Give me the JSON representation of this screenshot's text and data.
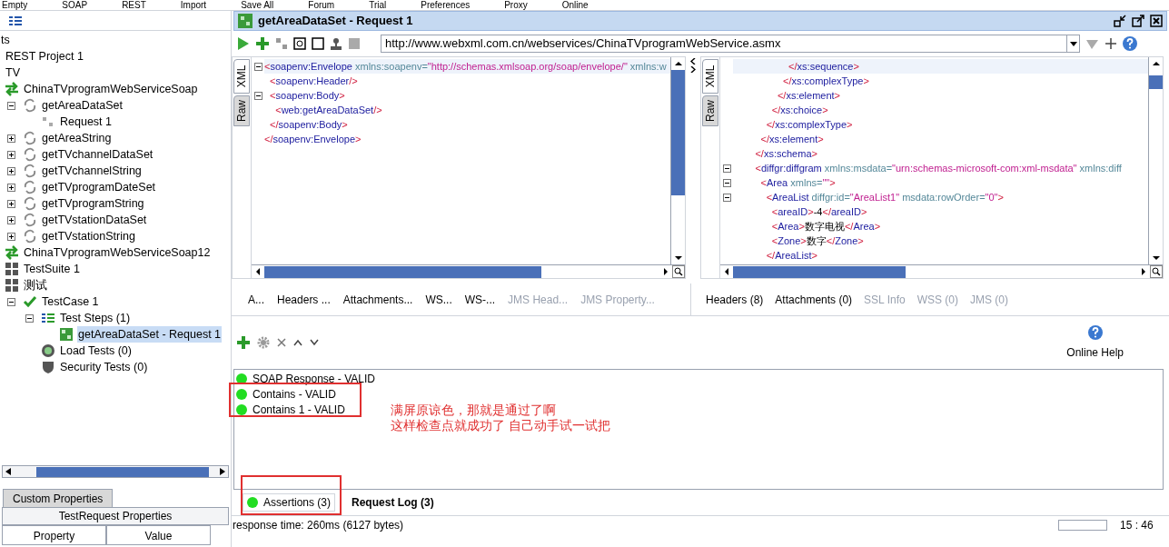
{
  "menu": [
    "Empty",
    "SOAP",
    "REST",
    "Import",
    "Save All",
    "Forum",
    "Trial",
    "Preferences",
    "Proxy",
    "Online"
  ],
  "tree": [
    {
      "label": "ts",
      "children": [
        {
          "label": "REST Project 1"
        },
        {
          "label": "TV",
          "children": [
            {
              "label": "ChinaTVprogramWebServiceSoap",
              "kind": "interface",
              "children": [
                {
                  "label": "getAreaDataSet",
                  "kind": "operation",
                  "expanded": true,
                  "children": [
                    {
                      "label": "Request 1",
                      "kind": "request"
                    }
                  ]
                },
                {
                  "label": "getAreaString",
                  "kind": "operation",
                  "expanded": false
                },
                {
                  "label": "getTVchannelDataSet",
                  "kind": "operation",
                  "expanded": false
                },
                {
                  "label": "getTVchannelString",
                  "kind": "operation",
                  "expanded": false
                },
                {
                  "label": "getTVprogramDateSet",
                  "kind": "operation",
                  "expanded": false
                },
                {
                  "label": "getTVprogramString",
                  "kind": "operation",
                  "expanded": false
                },
                {
                  "label": "getTVstationDataSet",
                  "kind": "operation",
                  "expanded": false
                },
                {
                  "label": "getTVstationString",
                  "kind": "operation",
                  "expanded": false
                }
              ]
            },
            {
              "label": "ChinaTVprogramWebServiceSoap12",
              "kind": "interface"
            },
            {
              "label": "TestSuite 1",
              "kind": "suite"
            },
            {
              "label": "测试",
              "kind": "suite",
              "children": [
                {
                  "label": "TestCase 1",
                  "kind": "case",
                  "expanded": true,
                  "children": [
                    {
                      "label": "Test Steps (1)",
                      "kind": "steps",
                      "expanded": true,
                      "children": [
                        {
                          "label": "getAreaDataSet - Request 1",
                          "kind": "step",
                          "selected": true
                        }
                      ]
                    },
                    {
                      "label": "Load Tests (0)",
                      "kind": "load"
                    },
                    {
                      "label": "Security Tests (0)",
                      "kind": "security"
                    }
                  ]
                }
              ]
            }
          ]
        }
      ]
    }
  ],
  "props": {
    "tabs": [
      {
        "label": "Custom Properties",
        "selected": true
      }
    ],
    "title": "TestRequest Properties",
    "columns": [
      "Property",
      "Value"
    ]
  },
  "editor": {
    "title": "getAreaDataSet - Request 1",
    "url": "http://www.webxml.com.cn/webservices/ChinaTVprogramWebService.asmx",
    "request": {
      "side_tabs": [
        "XML",
        "Raw"
      ],
      "lines": [
        {
          "fold": true,
          "parts": [
            {
              "kind": "punct",
              "text": "<"
            },
            {
              "kind": "tag",
              "text": "soapenv:Envelope"
            },
            {
              "kind": "attr",
              "text": " xmlns:soapenv="
            },
            {
              "kind": "value",
              "text": "\"http://schemas.xmlsoap.org/soap/envelope/\""
            },
            {
              "kind": "attr",
              "text": " xmlns:w"
            }
          ]
        },
        {
          "fold": false,
          "parts": [
            {
              "kind": "punct",
              "text": "  <"
            },
            {
              "kind": "tag",
              "text": "soapenv:Header"
            },
            {
              "kind": "punct",
              "text": "/>"
            }
          ]
        },
        {
          "fold": true,
          "parts": [
            {
              "kind": "punct",
              "text": "  <"
            },
            {
              "kind": "tag",
              "text": "soapenv:Body"
            },
            {
              "kind": "punct",
              "text": ">"
            }
          ]
        },
        {
          "fold": false,
          "parts": [
            {
              "kind": "punct",
              "text": "    <"
            },
            {
              "kind": "tag",
              "text": "web:getAreaDataSet"
            },
            {
              "kind": "punct",
              "text": "/>"
            }
          ]
        },
        {
          "fold": false,
          "parts": [
            {
              "kind": "punct",
              "text": "  </"
            },
            {
              "kind": "tag",
              "text": "soapenv:Body"
            },
            {
              "kind": "punct",
              "text": ">"
            }
          ]
        },
        {
          "fold": false,
          "parts": [
            {
              "kind": "punct",
              "text": "</"
            },
            {
              "kind": "tag",
              "text": "soapenv:Envelope"
            },
            {
              "kind": "punct",
              "text": ">"
            }
          ]
        }
      ],
      "tabs": [
        {
          "label": "A...",
          "disabled": false
        },
        {
          "label": "Headers ...",
          "disabled": false
        },
        {
          "label": "Attachments...",
          "disabled": false
        },
        {
          "label": "WS...",
          "disabled": false
        },
        {
          "label": "WS-...",
          "disabled": false
        },
        {
          "label": "JMS Head...",
          "disabled": true
        },
        {
          "label": "JMS Property...",
          "disabled": true
        }
      ]
    },
    "response": {
      "side_tabs": [
        "XML",
        "Raw"
      ],
      "lines": [
        {
          "fold": false,
          "parts": [
            {
              "kind": "punct",
              "text": "                    </"
            },
            {
              "kind": "tag",
              "text": "xs:sequence"
            },
            {
              "kind": "punct",
              "text": ">"
            }
          ]
        },
        {
          "fold": false,
          "parts": [
            {
              "kind": "punct",
              "text": "                  </"
            },
            {
              "kind": "tag",
              "text": "xs:complexType"
            },
            {
              "kind": "punct",
              "text": ">"
            }
          ]
        },
        {
          "fold": false,
          "parts": [
            {
              "kind": "punct",
              "text": "                </"
            },
            {
              "kind": "tag",
              "text": "xs:element"
            },
            {
              "kind": "punct",
              "text": ">"
            }
          ]
        },
        {
          "fold": false,
          "parts": [
            {
              "kind": "punct",
              "text": "              </"
            },
            {
              "kind": "tag",
              "text": "xs:choice"
            },
            {
              "kind": "punct",
              "text": ">"
            }
          ]
        },
        {
          "fold": false,
          "parts": [
            {
              "kind": "punct",
              "text": "            </"
            },
            {
              "kind": "tag",
              "text": "xs:complexType"
            },
            {
              "kind": "punct",
              "text": ">"
            }
          ]
        },
        {
          "fold": false,
          "parts": [
            {
              "kind": "punct",
              "text": "          </"
            },
            {
              "kind": "tag",
              "text": "xs:element"
            },
            {
              "kind": "punct",
              "text": ">"
            }
          ]
        },
        {
          "fold": false,
          "parts": [
            {
              "kind": "punct",
              "text": "        </"
            },
            {
              "kind": "tag",
              "text": "xs:schema"
            },
            {
              "kind": "punct",
              "text": ">"
            }
          ]
        },
        {
          "fold": true,
          "parts": [
            {
              "kind": "punct",
              "text": "        <"
            },
            {
              "kind": "tag",
              "text": "diffgr:diffgram"
            },
            {
              "kind": "attr",
              "text": " xmlns:msdata="
            },
            {
              "kind": "value",
              "text": "\"urn:schemas-microsoft-com:xml-msdata\""
            },
            {
              "kind": "attr",
              "text": " xmlns:diff"
            }
          ]
        },
        {
          "fold": true,
          "parts": [
            {
              "kind": "punct",
              "text": "          <"
            },
            {
              "kind": "tag",
              "text": "Area"
            },
            {
              "kind": "attr",
              "text": " xmlns="
            },
            {
              "kind": "value",
              "text": "\"\""
            },
            {
              "kind": "punct",
              "text": ">"
            }
          ]
        },
        {
          "fold": true,
          "parts": [
            {
              "kind": "punct",
              "text": "            <"
            },
            {
              "kind": "tag",
              "text": "AreaList"
            },
            {
              "kind": "attr",
              "text": " diffgr:id="
            },
            {
              "kind": "value",
              "text": "\"AreaList1\""
            },
            {
              "kind": "attr",
              "text": " msdata:rowOrder="
            },
            {
              "kind": "value",
              "text": "\"0\""
            },
            {
              "kind": "punct",
              "text": ">"
            }
          ]
        },
        {
          "fold": false,
          "parts": [
            {
              "kind": "punct",
              "text": "              <"
            },
            {
              "kind": "tag",
              "text": "areaID"
            },
            {
              "kind": "punct",
              "text": ">"
            },
            {
              "kind": "text",
              "text": "-4"
            },
            {
              "kind": "punct",
              "text": "</"
            },
            {
              "kind": "tag",
              "text": "areaID"
            },
            {
              "kind": "punct",
              "text": ">"
            }
          ]
        },
        {
          "fold": false,
          "parts": [
            {
              "kind": "punct",
              "text": "              <"
            },
            {
              "kind": "tag",
              "text": "Area"
            },
            {
              "kind": "punct",
              "text": ">"
            },
            {
              "kind": "text",
              "text": "数字电视"
            },
            {
              "kind": "punct",
              "text": "</"
            },
            {
              "kind": "tag",
              "text": "Area"
            },
            {
              "kind": "punct",
              "text": ">"
            }
          ]
        },
        {
          "fold": false,
          "parts": [
            {
              "kind": "punct",
              "text": "              <"
            },
            {
              "kind": "tag",
              "text": "Zone"
            },
            {
              "kind": "punct",
              "text": ">"
            },
            {
              "kind": "text",
              "text": "数字"
            },
            {
              "kind": "punct",
              "text": "</"
            },
            {
              "kind": "tag",
              "text": "Zone"
            },
            {
              "kind": "punct",
              "text": ">"
            }
          ]
        },
        {
          "fold": false,
          "parts": [
            {
              "kind": "punct",
              "text": "            </"
            },
            {
              "kind": "tag",
              "text": "AreaList"
            },
            {
              "kind": "punct",
              "text": ">"
            }
          ]
        }
      ],
      "tabs": [
        {
          "label": "Headers (8)",
          "disabled": false
        },
        {
          "label": "Attachments (0)",
          "disabled": false
        },
        {
          "label": "SSL Info",
          "disabled": true
        },
        {
          "label": "WSS (0)",
          "disabled": true
        },
        {
          "label": "JMS (0)",
          "disabled": true
        }
      ]
    }
  },
  "assertions": {
    "help": "Online Help",
    "items": [
      {
        "label": "SOAP Response - VALID",
        "color": "#22dd22"
      },
      {
        "label": "Contains - VALID",
        "color": "#22dd22"
      },
      {
        "label": "Contains 1 - VALID",
        "color": "#22dd22"
      }
    ],
    "note": [
      "满屏原谅色，那就是通过了啊",
      "这样检查点就成功了 自己动手试一试把"
    ]
  },
  "bottom_tabs": [
    {
      "label": "Assertions (3)",
      "selected": true,
      "color": "#22dd22"
    },
    {
      "label": "Request Log (3)",
      "selected": false
    }
  ],
  "status_bar": {
    "text": "response time: 260ms (6127 bytes)",
    "time": "15 : 46"
  }
}
